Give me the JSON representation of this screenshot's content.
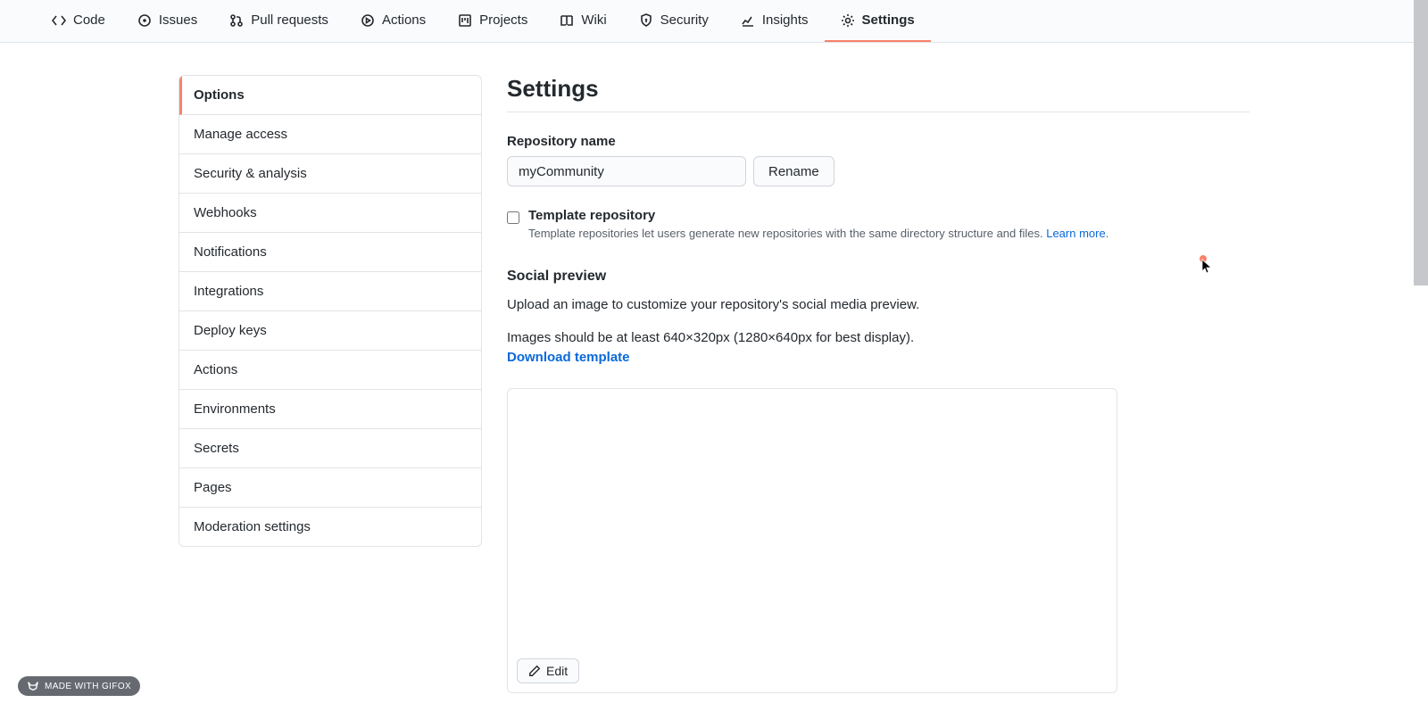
{
  "tabs": [
    {
      "label": "Code",
      "icon": "code"
    },
    {
      "label": "Issues",
      "icon": "issue"
    },
    {
      "label": "Pull requests",
      "icon": "pr"
    },
    {
      "label": "Actions",
      "icon": "play"
    },
    {
      "label": "Projects",
      "icon": "project"
    },
    {
      "label": "Wiki",
      "icon": "book"
    },
    {
      "label": "Security",
      "icon": "shield"
    },
    {
      "label": "Insights",
      "icon": "graph"
    },
    {
      "label": "Settings",
      "icon": "gear",
      "active": true
    }
  ],
  "sidebar": {
    "items": [
      {
        "label": "Options",
        "active": true
      },
      {
        "label": "Manage access"
      },
      {
        "label": "Security & analysis"
      },
      {
        "label": "Webhooks"
      },
      {
        "label": "Notifications"
      },
      {
        "label": "Integrations"
      },
      {
        "label": "Deploy keys"
      },
      {
        "label": "Actions"
      },
      {
        "label": "Environments"
      },
      {
        "label": "Secrets"
      },
      {
        "label": "Pages"
      },
      {
        "label": "Moderation settings"
      }
    ]
  },
  "page": {
    "title": "Settings",
    "repo_name": {
      "label": "Repository name",
      "value": "myCommunity",
      "rename_btn": "Rename"
    },
    "template": {
      "label": "Template repository",
      "sub": "Template repositories let users generate new repositories with the same directory structure and files. ",
      "learn_more": "Learn more",
      "checked": false
    },
    "social": {
      "heading": "Social preview",
      "line1": "Upload an image to customize your repository's social media preview.",
      "line2": "Images should be at least 640×320px (1280×640px for best display).",
      "download": "Download template",
      "edit_btn": "Edit"
    }
  },
  "badge": "MADE WITH GIFOX"
}
